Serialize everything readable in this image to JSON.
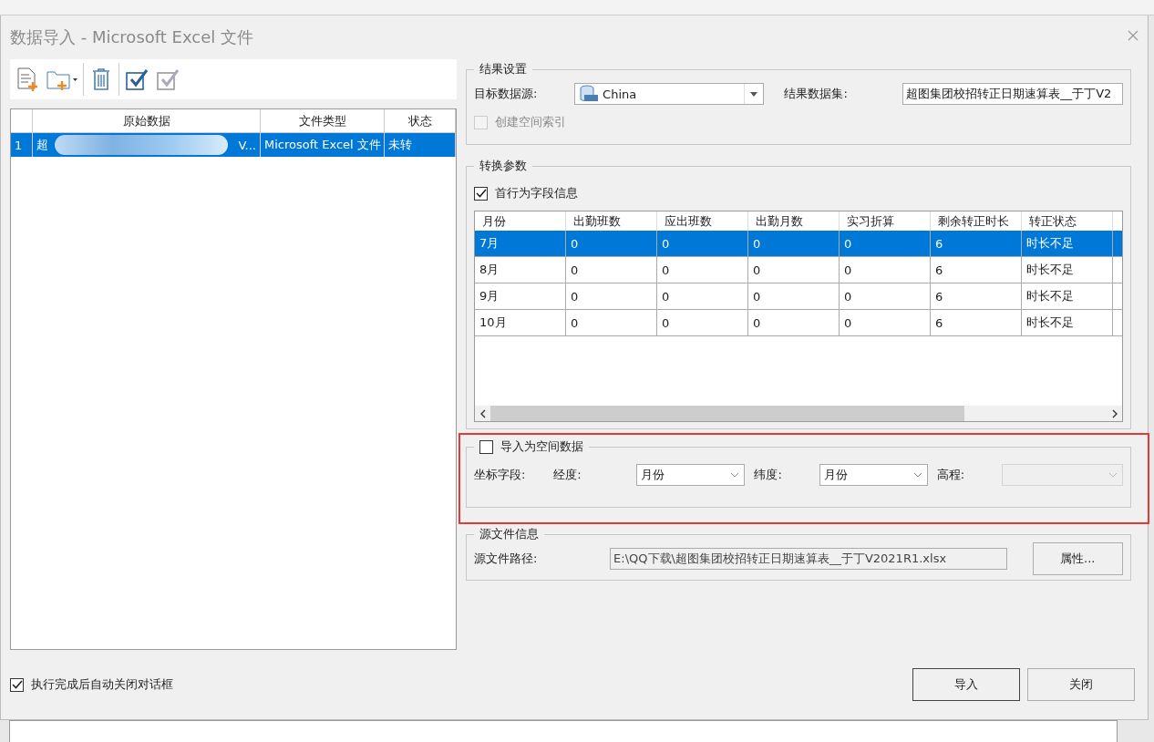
{
  "window": {
    "title": "数据导入 - Microsoft Excel 文件"
  },
  "file_list": {
    "columns": [
      "原始数据",
      "文件类型",
      "状态"
    ],
    "rows": [
      {
        "index": "1",
        "name_start": "超",
        "name_end": "V...",
        "type": "Microsoft Excel 文件",
        "status": "未转",
        "selected": true
      }
    ]
  },
  "result_settings": {
    "title": "结果设置",
    "datasource_label": "目标数据源:",
    "datasource": "China",
    "dataset_label": "结果数据集:",
    "dataset": "超图集团校招转正日期速算表__于丁V2",
    "spatial_index": {
      "label": "创建空间索引",
      "checked": false,
      "disabled": true
    }
  },
  "conversion": {
    "title": "转换参数",
    "first_row": {
      "label": "首行为字段信息",
      "checked": true
    },
    "table": {
      "columns": [
        "月份",
        "出勤班数",
        "应出班数",
        "出勤月数",
        "实习折算",
        "剩余转正时长",
        "转正状态"
      ],
      "rows": [
        {
          "cells": [
            "7月",
            "0",
            "0",
            "0",
            "0",
            "6",
            "时长不足"
          ],
          "selected": true
        },
        {
          "cells": [
            "8月",
            "0",
            "0",
            "0",
            "0",
            "6",
            "时长不足"
          ],
          "selected": false
        },
        {
          "cells": [
            "9月",
            "0",
            "0",
            "0",
            "0",
            "6",
            "时长不足"
          ],
          "selected": false
        },
        {
          "cells": [
            "10月",
            "0",
            "0",
            "0",
            "0",
            "6",
            "时长不足"
          ],
          "selected": false
        }
      ]
    }
  },
  "spatial": {
    "highlighted": true,
    "label": "导入为空间数据",
    "checked": false,
    "coord_label": "坐标字段:",
    "fields": [
      {
        "label": "经度:",
        "value": "月份"
      },
      {
        "label": "纬度:",
        "value": "月份"
      },
      {
        "label": "高程:"
      }
    ]
  },
  "source": {
    "title": "源文件信息",
    "path_label": "源文件路径:",
    "path": "E:\\QQ下载\\超图集团校招转正日期速算表__于丁V2021R1.xlsx",
    "properties_button": "属性..."
  },
  "auto_close": {
    "label": "执行完成后自动关闭对话框",
    "checked": true
  },
  "buttons": [
    "导入",
    "关闭"
  ]
}
